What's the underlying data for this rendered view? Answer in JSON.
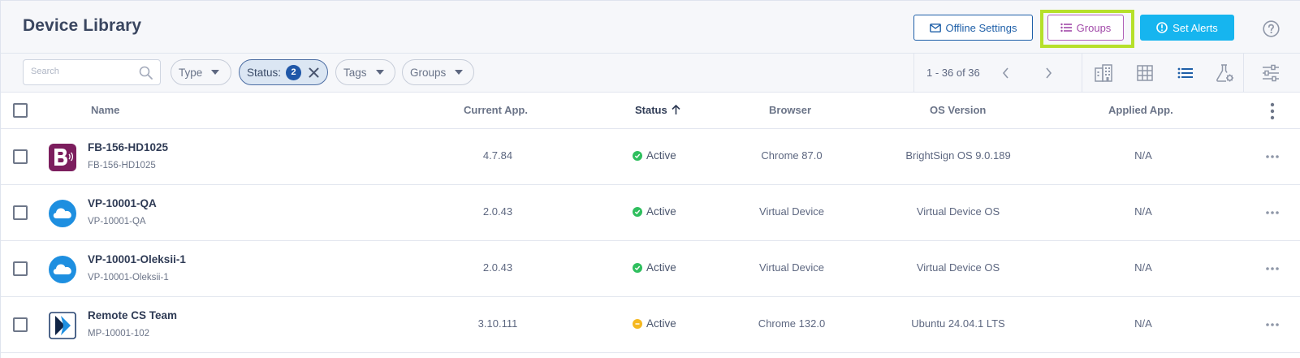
{
  "header": {
    "title": "Device Library",
    "offline_settings_label": "Offline Settings",
    "groups_label": "Groups",
    "set_alerts_label": "Set Alerts",
    "help_icon": "help-circle-icon"
  },
  "toolbar": {
    "search_placeholder": "Search",
    "filters": {
      "type_label": "Type",
      "status_label": "Status:",
      "status_count": "2",
      "tags_label": "Tags",
      "groups_label": "Groups"
    },
    "pagination": "1 - 36 of 36",
    "views": [
      "building-view-icon",
      "grid-view-icon",
      "list-view-icon",
      "lab-settings-icon",
      "sliders-icon"
    ]
  },
  "table": {
    "columns": {
      "name": "Name",
      "current_app": "Current App.",
      "status": "Status",
      "browser": "Browser",
      "os_version": "OS Version",
      "applied_app": "Applied App."
    },
    "rows": [
      {
        "name": "FB-156-HD1025",
        "id": "FB-156-HD1025",
        "current_app": "4.7.84",
        "status": "Active",
        "status_color": "#2fbf5e",
        "browser": "Chrome 87.0",
        "os_version": "BrightSign OS 9.0.189",
        "applied_app": "N/A",
        "avatar": "brightsign-logo-icon"
      },
      {
        "name": "VP-10001-QA",
        "id": "VP-10001-QA",
        "current_app": "2.0.43",
        "status": "Active",
        "status_color": "#2fbf5e",
        "browser": "Virtual Device",
        "os_version": "Virtual Device OS",
        "applied_app": "N/A",
        "avatar": "cloud-icon"
      },
      {
        "name": "VP-10001-Oleksii-1",
        "id": "VP-10001-Oleksii-1",
        "current_app": "2.0.43",
        "status": "Active",
        "status_color": "#2fbf5e",
        "browser": "Virtual Device",
        "os_version": "Virtual Device OS",
        "applied_app": "N/A",
        "avatar": "cloud-icon"
      },
      {
        "name": "Remote CS Team",
        "id": "MP-10001-102",
        "current_app": "3.10.111",
        "status": "Active",
        "status_color": "#f5b820",
        "browser": "Chrome 132.0",
        "os_version": "Ubuntu 24.04.1 LTS",
        "applied_app": "N/A",
        "avatar": "media-player-logo-icon"
      }
    ]
  },
  "colors": {
    "primary": "#1e5fa8",
    "accent": "#16b5ef",
    "groups_purple": "#a24aa9",
    "highlight": "#b6e02a"
  }
}
